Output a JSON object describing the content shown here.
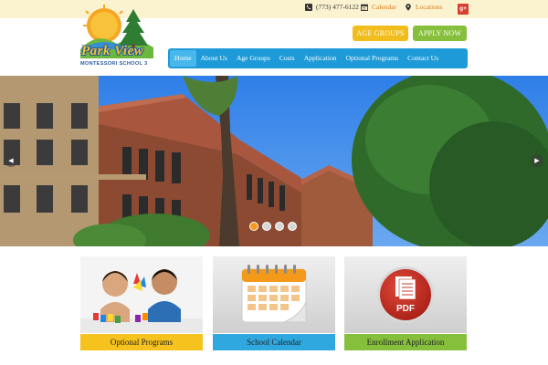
{
  "topbar": {
    "phone": "(773) 477-6122",
    "calendar_label": "Calendar",
    "locations_label": "Locations",
    "gplus_label": "g+"
  },
  "logo": {
    "title": "Park View",
    "subtitle": "MONTESSORI SCHOOL 3"
  },
  "cta": {
    "age_groups": "AGE GROUPS",
    "apply_now": "APPLY NOW"
  },
  "nav": {
    "items": [
      {
        "label": "Home"
      },
      {
        "label": "About Us"
      },
      {
        "label": "Age Groups"
      },
      {
        "label": "Costs"
      },
      {
        "label": "Application"
      },
      {
        "label": "Optional Programs"
      },
      {
        "label": "Contact Us"
      }
    ],
    "active_index": 0
  },
  "hero": {
    "slide_count": 4,
    "active_slide": 1
  },
  "cards": [
    {
      "caption": "Optional Programs",
      "color": "#f6c21e"
    },
    {
      "caption": "School Calendar",
      "color": "#2fa8df"
    },
    {
      "caption": "Enrollment Application",
      "color": "#86bf3b"
    }
  ],
  "pdf_label": "PDF",
  "colors": {
    "nav_blue": "#1e9ad8",
    "topbar_bg": "#fbf2cf",
    "accent_yellow": "#f1bd1c",
    "accent_green": "#86bf3b",
    "accent_orange": "#d87a16"
  }
}
